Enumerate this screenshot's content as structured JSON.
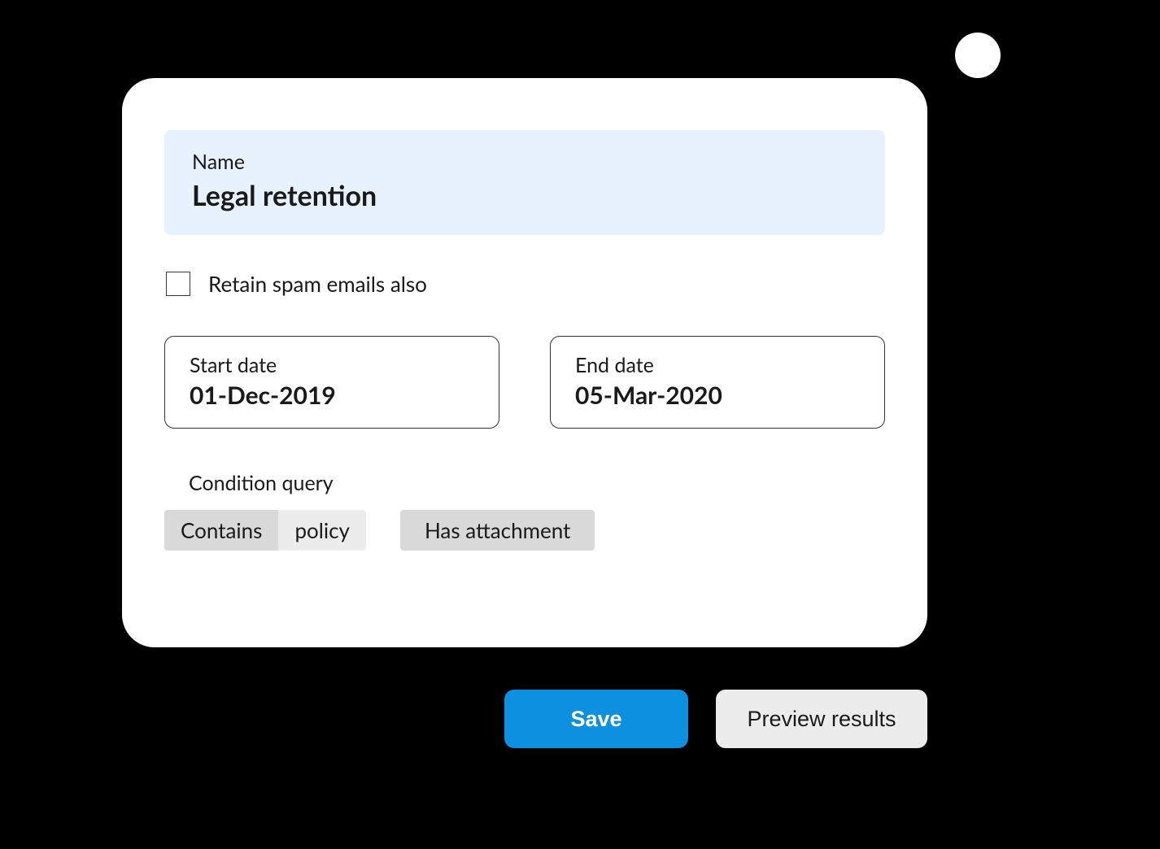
{
  "name": {
    "label": "Name",
    "value": "Legal retention"
  },
  "retain_spam": {
    "label": "Retain spam emails also",
    "checked": false
  },
  "dates": {
    "start": {
      "label": "Start date",
      "value": "01-Dec-2019"
    },
    "end": {
      "label": "End date",
      "value": "05-Mar-2020"
    }
  },
  "condition": {
    "heading": "Condition query",
    "chips": [
      {
        "op": "Contains",
        "value": "policy"
      },
      {
        "label": "Has attachment"
      }
    ]
  },
  "actions": {
    "save": "Save",
    "preview": "Preview results"
  }
}
